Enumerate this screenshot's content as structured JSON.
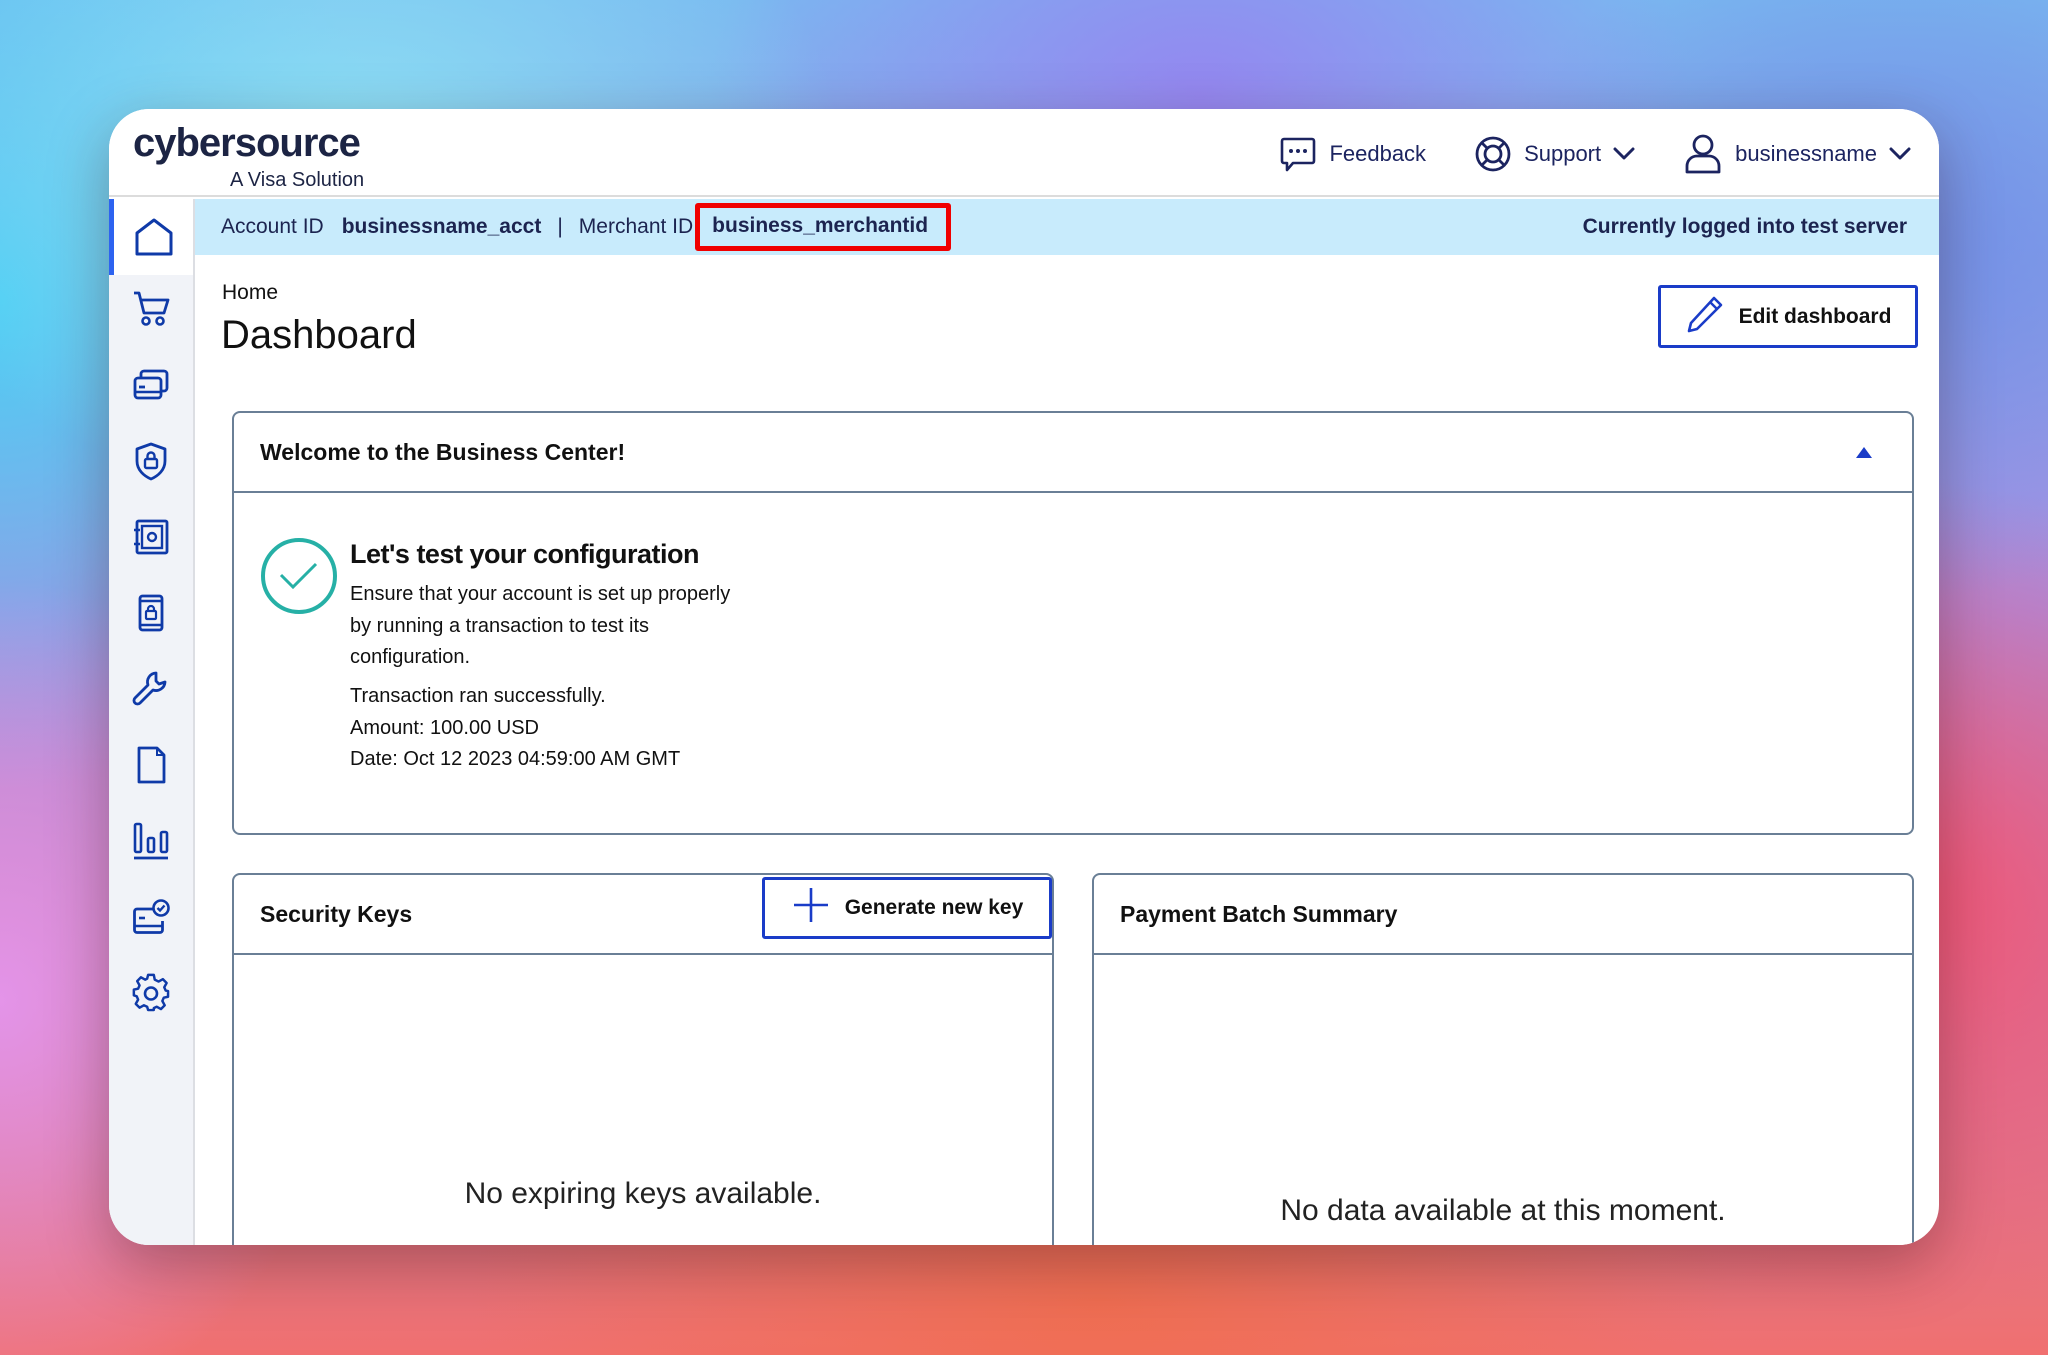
{
  "header": {
    "logo_main": "cybersource",
    "logo_sub": "A Visa Solution",
    "nav": {
      "feedback": "Feedback",
      "support": "Support",
      "user": "businessname"
    }
  },
  "infobar": {
    "account_label": "Account ID",
    "account_value": "businessname_acct",
    "separator": "|",
    "merchant_label": "Merchant ID",
    "merchant_value": "business_merchantid",
    "status": "Currently logged into test server"
  },
  "sidebar": {
    "items": [
      {
        "icon": "home-icon",
        "active": true
      },
      {
        "icon": "cart-icon"
      },
      {
        "icon": "cards-icon"
      },
      {
        "icon": "shield-lock-icon"
      },
      {
        "icon": "vault-icon"
      },
      {
        "icon": "mobile-lock-icon"
      },
      {
        "icon": "wrench-icon"
      },
      {
        "icon": "document-icon"
      },
      {
        "icon": "bar-chart-icon"
      },
      {
        "icon": "card-check-icon"
      },
      {
        "icon": "gear-icon"
      }
    ]
  },
  "page": {
    "breadcrumb": "Home",
    "title": "Dashboard",
    "edit_button": "Edit dashboard"
  },
  "welcome_card": {
    "title": "Welcome to the Business Center!",
    "config_title": "Let's test your configuration",
    "config_desc": "Ensure that your account is set up properly by running a transaction to test its configuration.",
    "result_status": "Transaction ran successfully.",
    "result_amount": "Amount: 100.00 USD",
    "result_date": "Date: Oct 12 2023 04:59:00 AM GMT"
  },
  "security_keys_card": {
    "title": "Security Keys",
    "generate_button": "Generate new key",
    "empty_text": "No expiring keys available."
  },
  "payment_batch_card": {
    "title": "Payment Batch Summary",
    "empty_text": "No data available at this moment."
  },
  "colors": {
    "accent": "#1a3cc8",
    "info_bar_bg": "#c8ebfc",
    "highlight": "#f00000",
    "success": "#26b0a6"
  }
}
